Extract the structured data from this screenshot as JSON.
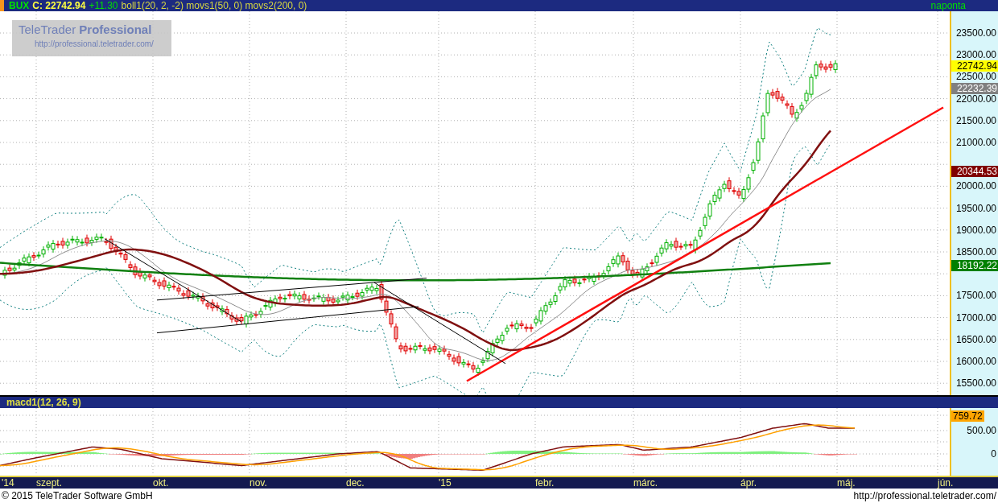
{
  "header": {
    "symbol": "BUX",
    "close": "C: 22742.94",
    "change": "+11.30",
    "indicators": "boll1(20, 2, -2) movs1(50, 0) movs2(200, 0)",
    "interval": "naponta"
  },
  "logo": {
    "title": "TeleTrader",
    "title_bold": "Professional",
    "url": "http://professional.teletrader.com/"
  },
  "price_axis": [
    "23500.00",
    "23000.00",
    "22500.00",
    "22000.00",
    "21500.00",
    "21000.00",
    "20000.00",
    "19500.00",
    "19000.00",
    "18500.00",
    "17500.00",
    "17000.00",
    "16500.00",
    "16000.00",
    "15500.00"
  ],
  "price_badges": [
    {
      "text": "22742.94",
      "color": "#ffff00"
    },
    {
      "text": "22232.39",
      "color": "#808080"
    },
    {
      "text": "20344.53",
      "color": "#800000"
    },
    {
      "text": "18192.22",
      "color": "#008000"
    }
  ],
  "macd": {
    "title": "macd1(12, 26, 9)",
    "axis": [
      "500.00",
      "0"
    ],
    "badge": {
      "text": "759.72",
      "color": "#ffa500"
    }
  },
  "date_axis": [
    "'14",
    "szept.",
    "okt.",
    "nov.",
    "dec.",
    "'15",
    "febr.",
    "márc.",
    "ápr.",
    "máj.",
    "jún."
  ],
  "footer": {
    "copyright": "© 2015 TeleTrader Software GmbH",
    "url": "http://professional.teletrader.com/"
  }
}
